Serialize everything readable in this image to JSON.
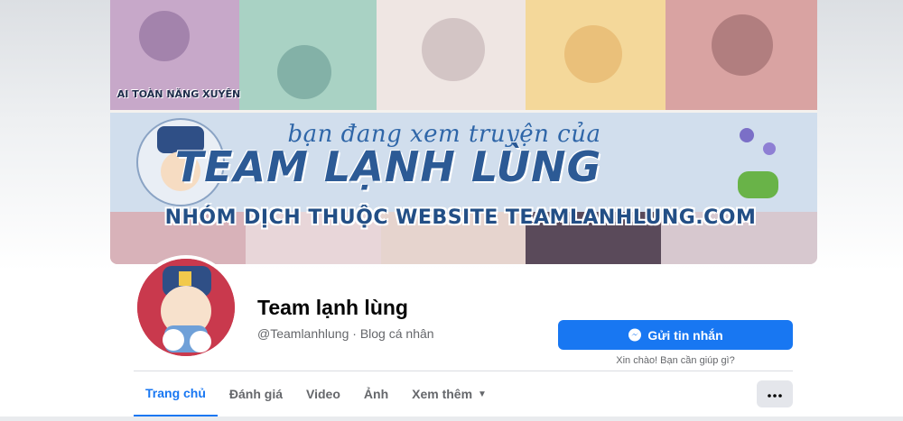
{
  "cover": {
    "banner_line1": "bạn đang xem truyện của",
    "banner_title": "TEAM LẠNH LÙNG",
    "banner_subtitle": "NHÓM DỊCH THUỘC WEBSITE TEAMLANHLUNG.COM",
    "tile_caption": "AI TOÀN NĂNG XUYÊN"
  },
  "profile": {
    "name": "Team lạnh lùng",
    "meta": "@Teamlanhlung · Blog cá nhân"
  },
  "actions": {
    "message_label": "Gửi tin nhắn",
    "message_hint": "Xin chào! Bạn cần giúp gì?"
  },
  "tabs": [
    {
      "label": "Trang chủ"
    },
    {
      "label": "Đánh giá"
    },
    {
      "label": "Video"
    },
    {
      "label": "Ảnh"
    },
    {
      "label": "Xem thêm"
    }
  ],
  "colors": {
    "accent": "#1877f2",
    "text_primary": "#050505",
    "text_secondary": "#65676b"
  },
  "icons": {
    "messenger": "messenger-icon",
    "more": "more-dots-icon",
    "caret": "caret-down-icon"
  }
}
